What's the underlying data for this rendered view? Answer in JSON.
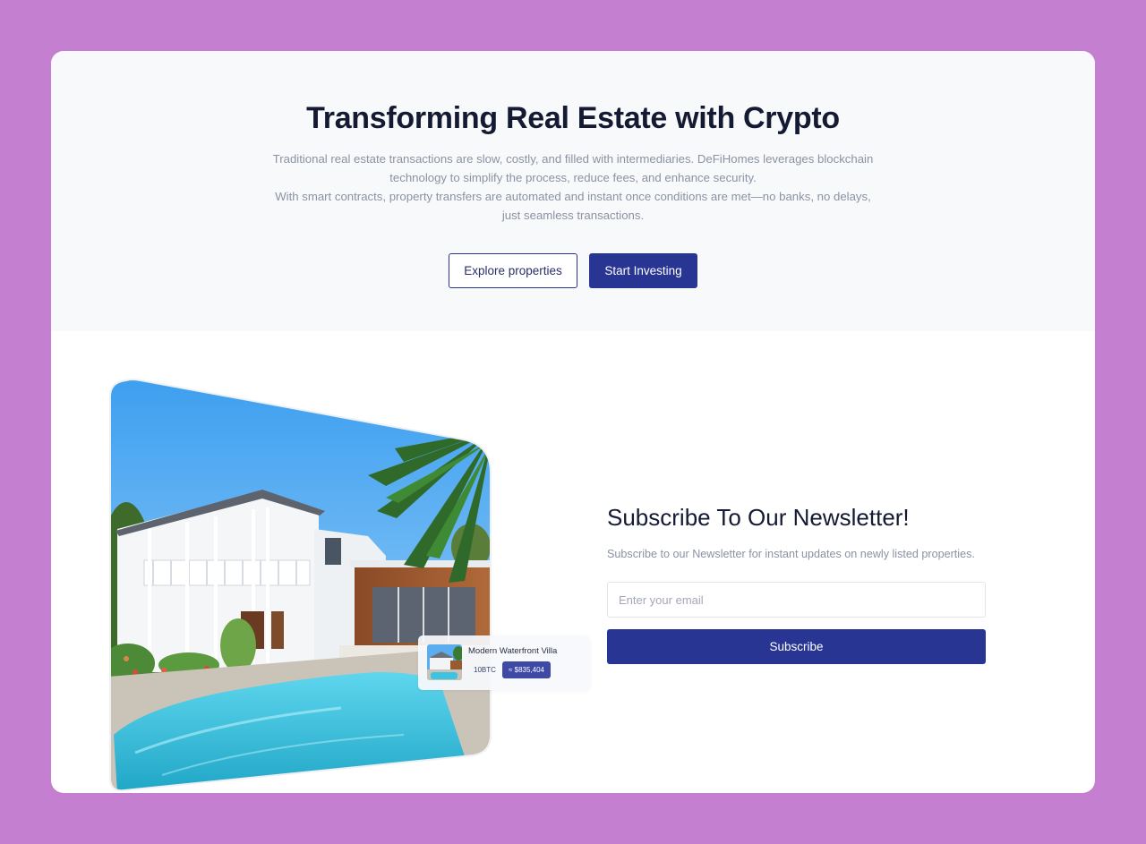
{
  "hero": {
    "title": "Transforming Real Estate with Crypto",
    "paragraph_1": "Traditional real estate transactions are slow, costly, and filled with intermediaries. DeFiHomes leverages blockchain technology to simplify the process, reduce fees, and enhance security.",
    "paragraph_2": "With smart contracts, property transfers are automated and instant once conditions are met—no banks, no delays, just seamless transactions.",
    "explore_label": "Explore properties",
    "invest_label": "Start Investing"
  },
  "listing_card": {
    "name": "Modern Waterfront Villa",
    "price_btc": "10BTC",
    "price_usd": "≈ $835,404"
  },
  "newsletter": {
    "title": "Subscribe To Our Newsletter!",
    "subtitle": "Subscribe to our Newsletter for instant updates on newly listed properties.",
    "email_placeholder": "Enter your email",
    "subscribe_label": "Subscribe"
  },
  "colors": {
    "page_background": "#c47fd0",
    "primary": "#283593",
    "hero_background": "#f8f9fb"
  }
}
